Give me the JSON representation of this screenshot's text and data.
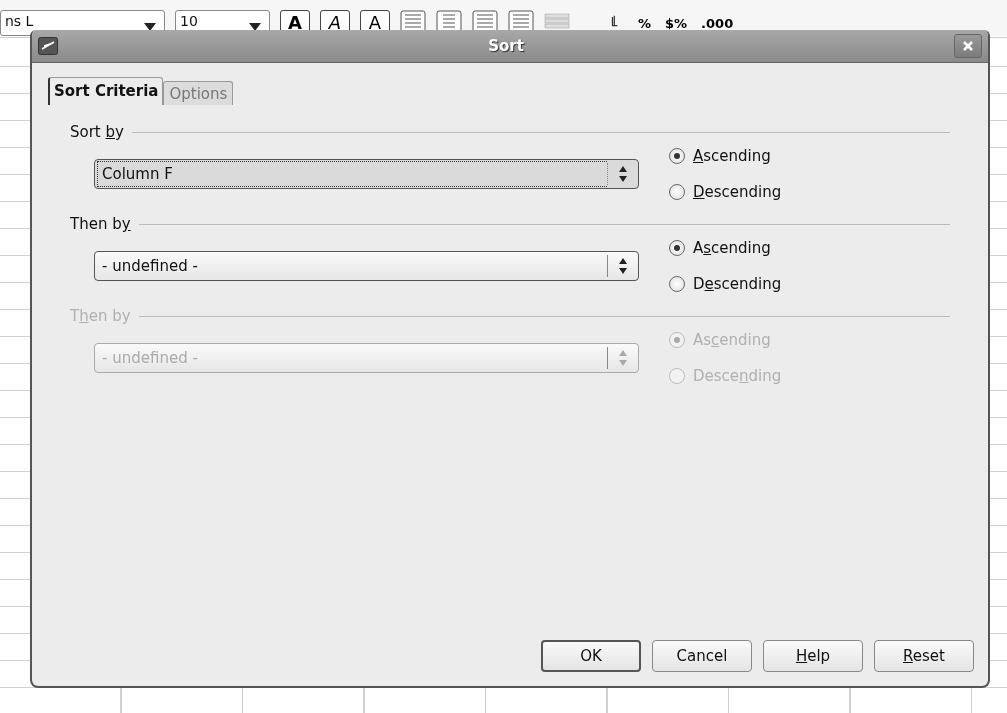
{
  "toolbar": {
    "font_name": "ns L",
    "font_size": "10",
    "format_buttons": [
      {
        "label": "A",
        "kind": "bold"
      },
      {
        "label": "A",
        "kind": "italic"
      },
      {
        "label": "A",
        "kind": "underline"
      }
    ],
    "number_buttons": [
      {
        "label": "%"
      },
      {
        "label": "$%"
      },
      {
        "label": ".000"
      }
    ]
  },
  "dialog": {
    "title": "Sort",
    "tabs": [
      {
        "label": "Sort Criteria",
        "selected": true
      },
      {
        "label": "Options",
        "selected": false
      }
    ],
    "groups": [
      {
        "label": {
          "pre": "Sort ",
          "key": "b",
          "post": "y"
        },
        "disabled": false,
        "field": {
          "value": "Column F",
          "focused": true
        },
        "options": [
          {
            "label": {
              "key": "A",
              "post": "scending"
            },
            "selected": true
          },
          {
            "label": {
              "key": "D",
              "post": "escending"
            },
            "selected": false
          }
        ]
      },
      {
        "label": {
          "pre": "Then b",
          "key": "y"
        },
        "disabled": false,
        "field": {
          "value": "- undefined -",
          "focused": false
        },
        "options": [
          {
            "label": {
              "pre": "A",
              "key": "s",
              "post": "cending"
            },
            "selected": true
          },
          {
            "label": {
              "pre": "D",
              "key": "e",
              "post": "scending"
            },
            "selected": false
          }
        ]
      },
      {
        "label": {
          "pre": "T",
          "key": "h",
          "post": "en by"
        },
        "disabled": true,
        "field": {
          "value": "- undefined -",
          "focused": false
        },
        "options": [
          {
            "label": {
              "pre": "As",
              "key": "c",
              "post": "ending"
            },
            "selected": true
          },
          {
            "label": {
              "pre": "Desce",
              "key": "n",
              "post": "ding"
            },
            "selected": false
          }
        ]
      }
    ],
    "buttons": [
      {
        "label": {
          "pre": "OK"
        },
        "default": true
      },
      {
        "label": {
          "pre": "Cancel"
        },
        "default": false
      },
      {
        "label": {
          "key": "H",
          "post": "elp"
        },
        "default": false
      },
      {
        "label": {
          "key": "R",
          "post": "eset"
        },
        "default": false
      }
    ]
  }
}
